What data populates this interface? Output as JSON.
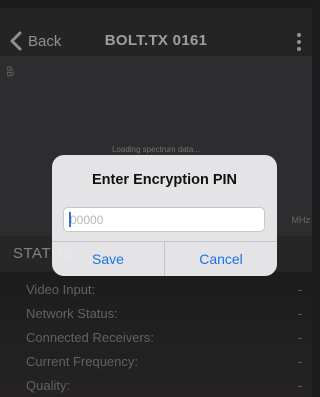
{
  "nav": {
    "back_label": "Back",
    "title": "BOLT.TX 0161",
    "back_icon": "chevron-left-icon",
    "menu_icon": "more-vertical-icon"
  },
  "spectrum": {
    "y_unit": "dB",
    "x_unit": "MHz",
    "loading_text": "Loading spectrum data..."
  },
  "status": {
    "title": "STATUS",
    "rows": [
      {
        "label": "Video Input:",
        "value": "-"
      },
      {
        "label": "Network Status:",
        "value": "-"
      },
      {
        "label": "Connected Receivers:",
        "value": "-"
      },
      {
        "label": "Current Frequency:",
        "value": "-"
      },
      {
        "label": "Quality:",
        "value": "-"
      }
    ]
  },
  "dialog": {
    "title": "Enter Encryption PIN",
    "pin_placeholder": "00000",
    "pin_value": "",
    "save_label": "Save",
    "cancel_label": "Cancel"
  },
  "colors": {
    "accent": "#1a73e8",
    "navbar": "#3a3a3c",
    "spectrum_bg": "#4a4a4c"
  }
}
